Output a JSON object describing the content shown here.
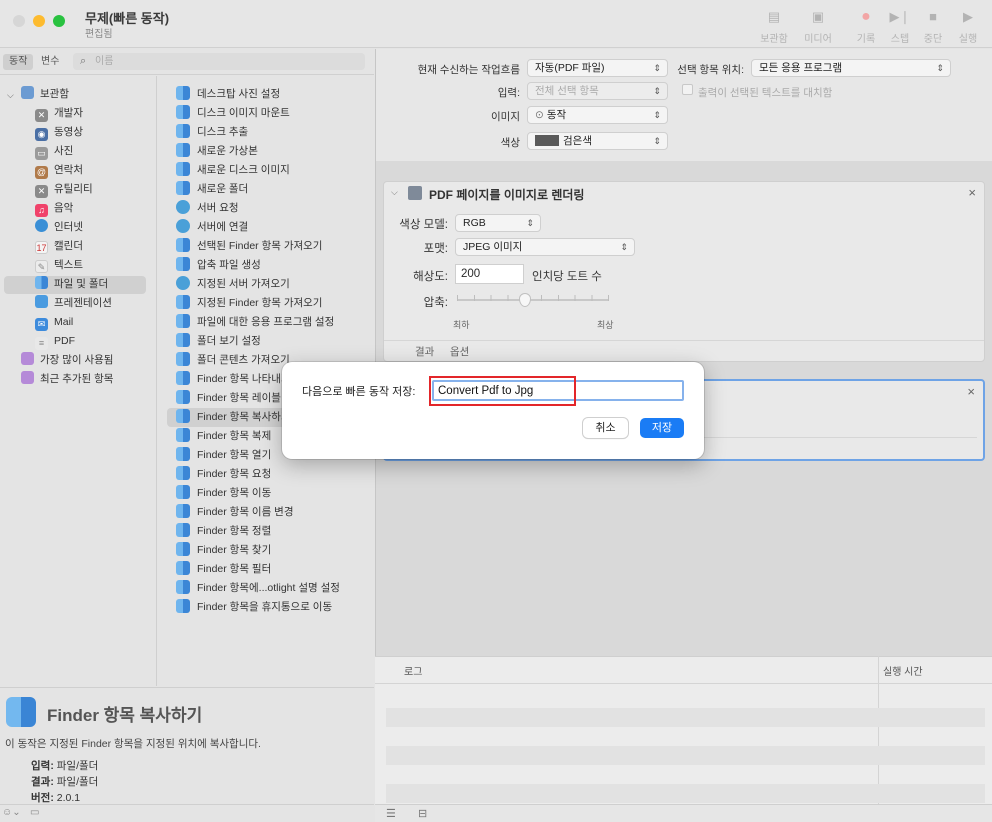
{
  "window": {
    "title": "무제(빠른 동작)",
    "subtitle": "편집됨",
    "toolbar": [
      {
        "label": "보관함",
        "icon": "library-icon"
      },
      {
        "label": "미디어",
        "icon": "media-icon"
      },
      {
        "label": "기록",
        "icon": "record-icon"
      },
      {
        "label": "스텝",
        "icon": "step-icon"
      },
      {
        "label": "중단",
        "icon": "stop-icon"
      },
      {
        "label": "실행",
        "icon": "run-icon"
      }
    ]
  },
  "library": {
    "tabs": [
      "동작",
      "변수"
    ],
    "search_placeholder": "이름",
    "categories": [
      {
        "label": "보관함",
        "color": "#6c9bd2"
      },
      {
        "label": "개발자",
        "color": "#7a7a7a"
      },
      {
        "label": "동영상",
        "color": "#4a6fa5"
      },
      {
        "label": "사진",
        "color": "#8a8a8a"
      },
      {
        "label": "연락처",
        "color": "#b07a4a"
      },
      {
        "label": "유틸리티",
        "color": "#7a7a7a"
      },
      {
        "label": "음악",
        "color": "#f0426a"
      },
      {
        "label": "인터넷",
        "color": "#3a8fd6"
      },
      {
        "label": "캘린더",
        "color": "#e0e0e0"
      },
      {
        "label": "텍스트",
        "color": "#d8d8d8"
      },
      {
        "label": "파일 및 폴더",
        "color": "#3a85d5"
      },
      {
        "label": "프레젠테이션",
        "color": "#4a9be0"
      },
      {
        "label": "Mail",
        "color": "#3d8bdc"
      },
      {
        "label": "PDF",
        "color": "#c8c8c8"
      },
      {
        "label": "가장 많이 사용됨",
        "color": "#b58ad8"
      },
      {
        "label": "최근 추가된 항목",
        "color": "#b58ad8"
      }
    ],
    "actions": [
      "데스크탑 사진 설정",
      "디스크 이미지 마운트",
      "디스크 추출",
      "새로운 가상본",
      "새로운 디스크 이미지",
      "새로운 폴더",
      "서버 요청",
      "서버에 연결",
      "선택된 Finder 항목 가져오기",
      "압축 파일 생성",
      "지정된 서버 가져오기",
      "지정된 Finder 항목 가져오기",
      "파일에 대한 응용 프로그램 설정",
      "폴더 보기 설정",
      "폴더 콘텐츠 가져오기",
      "Finder 항목 나타내기",
      "Finder 항목 레이블",
      "Finder 항목 복사하기",
      "Finder 항목 복제",
      "Finder 항목 열기",
      "Finder 항목 요청",
      "Finder 항목 이동",
      "Finder 항목 이름 변경",
      "Finder 항목 정렬",
      "Finder 항목 찾기",
      "Finder 항목 필터",
      "Finder 항목에...otlight 설명 설정",
      "Finder 항목을 휴지통으로 이동"
    ]
  },
  "info": {
    "title": "Finder 항목 복사하기",
    "description": "이 동작은 지정된 Finder 항목을 지정된 위치에 복사합니다.",
    "input_key": "입력:",
    "input_val": "파일/폴더",
    "result_key": "결과:",
    "result_val": "파일/폴더",
    "version_key": "버전:",
    "version_val": "2.0.1"
  },
  "workflow": {
    "receives_label": "현재 수신하는 작업흐름",
    "receives_value": "자동(PDF 파일)",
    "location_label": "선택 항목 위치:",
    "location_value": "모든 응용 프로그램",
    "input_label": "입력:",
    "input_value": "전체 선택 항목",
    "replace_text": "출력이 선택된 텍스트를 대치함",
    "image_label": "이미지",
    "image_value": "동작",
    "color_label": "색상",
    "color_value": "검은색"
  },
  "card1": {
    "title": "PDF 페이지를 이미지로 렌더링",
    "color_model_label": "색상 모델:",
    "color_model_value": "RGB",
    "format_label": "포맷:",
    "format_value": "JPEG 이미지",
    "resolution_label": "해상도:",
    "resolution_value": "200",
    "resolution_unit": "인치당 도트 수",
    "compression_label": "압축:",
    "slider_min": "최하",
    "slider_max": "최상",
    "compression_level": 0.45,
    "tab_results": "결과",
    "tab_options": "옵션"
  },
  "log": {
    "col_log": "로그",
    "col_time": "실행 시간"
  },
  "dialog": {
    "label": "다음으로 빠른 동작 저장:",
    "value": "Convert Pdf to Jpg",
    "cancel": "취소",
    "save": "저장"
  }
}
